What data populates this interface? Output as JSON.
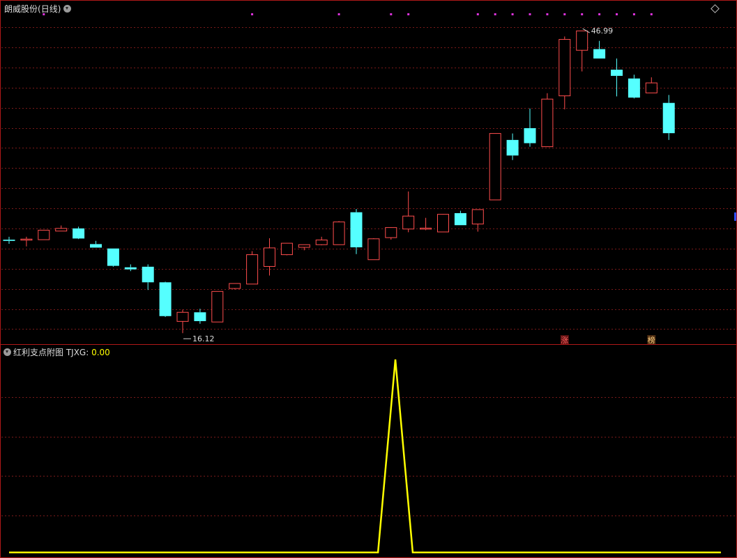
{
  "chart_data": [
    {
      "type": "candlestick",
      "title": "朗威股份",
      "period": "(日线)",
      "ylim": [
        15.0,
        48.7
      ],
      "grid": true,
      "colors": {
        "up": "#ff4d4d",
        "down": "#55ffff",
        "grid": "#7a1a1a",
        "divider": "#b01818"
      },
      "candles": [
        {
          "o": 25.66,
          "h": 25.96,
          "l": 25.24,
          "c": 25.54
        },
        {
          "o": 25.66,
          "h": 25.96,
          "l": 24.97,
          "c": 25.72
        },
        {
          "o": 25.66,
          "h": 26.6,
          "l": 25.72,
          "c": 26.63
        },
        {
          "o": 26.54,
          "h": 27.11,
          "l": 26.54,
          "c": 26.81
        },
        {
          "o": 26.81,
          "h": 26.99,
          "l": 25.72,
          "c": 25.78
        },
        {
          "o": 25.21,
          "h": 25.54,
          "l": 24.91,
          "c": 24.85
        },
        {
          "o": 24.76,
          "h": 24.76,
          "l": 22.9,
          "c": 22.99
        },
        {
          "o": 22.84,
          "h": 23.14,
          "l": 22.45,
          "c": 22.63
        },
        {
          "o": 22.9,
          "h": 23.14,
          "l": 20.53,
          "c": 21.31
        },
        {
          "o": 21.31,
          "h": 21.37,
          "l": 17.77,
          "c": 17.86
        },
        {
          "o": 17.32,
          "h": 18.52,
          "l": 16.12,
          "c": 18.25
        },
        {
          "o": 18.25,
          "h": 18.61,
          "l": 17.08,
          "c": 17.35
        },
        {
          "o": 17.26,
          "h": 20.38,
          "l": 17.26,
          "c": 20.38
        },
        {
          "o": 20.68,
          "h": 21.19,
          "l": 20.59,
          "c": 21.19
        },
        {
          "o": 21.13,
          "h": 24.49,
          "l": 21.13,
          "c": 24.13
        },
        {
          "o": 22.93,
          "h": 25.81,
          "l": 22.0,
          "c": 24.82
        },
        {
          "o": 24.13,
          "h": 25.21,
          "l": 24.07,
          "c": 25.3
        },
        {
          "o": 24.88,
          "h": 25.12,
          "l": 24.58,
          "c": 25.15
        },
        {
          "o": 25.15,
          "h": 25.96,
          "l": 25.09,
          "c": 25.63
        },
        {
          "o": 25.15,
          "h": 27.56,
          "l": 25.15,
          "c": 27.47
        },
        {
          "o": 28.46,
          "h": 28.79,
          "l": 24.19,
          "c": 24.88
        },
        {
          "o": 23.62,
          "h": 25.81,
          "l": 23.62,
          "c": 25.75
        },
        {
          "o": 25.87,
          "h": 26.93,
          "l": 25.66,
          "c": 26.9
        },
        {
          "o": 26.75,
          "h": 30.58,
          "l": 26.42,
          "c": 28.07
        },
        {
          "o": 26.84,
          "h": 27.89,
          "l": 26.63,
          "c": 26.84
        },
        {
          "o": 26.45,
          "h": 28.28,
          "l": 26.45,
          "c": 28.25
        },
        {
          "o": 28.37,
          "h": 28.61,
          "l": 27.23,
          "c": 27.14
        },
        {
          "o": 27.26,
          "h": 28.76,
          "l": 26.48,
          "c": 28.73
        },
        {
          "o": 29.72,
          "h": 29.72,
          "l": 29.72,
          "c": 36.5
        },
        {
          "o": 35.84,
          "h": 36.5,
          "l": 33.79,
          "c": 34.25
        },
        {
          "o": 37.04,
          "h": 39.05,
          "l": 35.15,
          "c": 35.51
        },
        {
          "o": 35.15,
          "h": 40.61,
          "l": 35.15,
          "c": 40.01
        },
        {
          "o": 40.34,
          "h": 46.4,
          "l": 38.96,
          "c": 46.1
        },
        {
          "o": 44.99,
          "h": 46.99,
          "l": 42.83,
          "c": 46.97
        },
        {
          "o": 45.11,
          "h": 45.95,
          "l": 44.15,
          "c": 44.15
        },
        {
          "o": 43.01,
          "h": 44.15,
          "l": 40.28,
          "c": 42.38
        },
        {
          "o": 42.11,
          "h": 42.5,
          "l": 40.07,
          "c": 40.16
        },
        {
          "o": 40.64,
          "h": 42.23,
          "l": 40.73,
          "c": 41.66
        },
        {
          "o": 39.62,
          "h": 40.43,
          "l": 35.84,
          "c": 36.53
        }
      ],
      "annotations": {
        "high": {
          "index": 33,
          "label": "46.99"
        },
        "low": {
          "index": 10,
          "label": "16.12"
        }
      },
      "marker_dots": {
        "indices": [
          2,
          14,
          19,
          22,
          23,
          27,
          28,
          29,
          30,
          31,
          32,
          33,
          34,
          35,
          36,
          37
        ],
        "color": "#dd33dd"
      },
      "badges": [
        {
          "index": 32,
          "text": "涨",
          "color": "#ff6060",
          "bg": "#5a1010"
        },
        {
          "index": 37,
          "text": "榜",
          "color": "#ffd080",
          "bg": "#4a2a10"
        }
      ]
    },
    {
      "type": "line",
      "title": "红利支点附图",
      "series": [
        {
          "name": "TJXG",
          "current": "0.00",
          "color": "#ffff00",
          "x": [
            0,
            21.25,
            22.25,
            23.25,
            41.0
          ],
          "values": [
            0,
            0,
            1,
            0,
            0
          ]
        }
      ],
      "ylim": [
        0,
        1.0
      ]
    }
  ]
}
